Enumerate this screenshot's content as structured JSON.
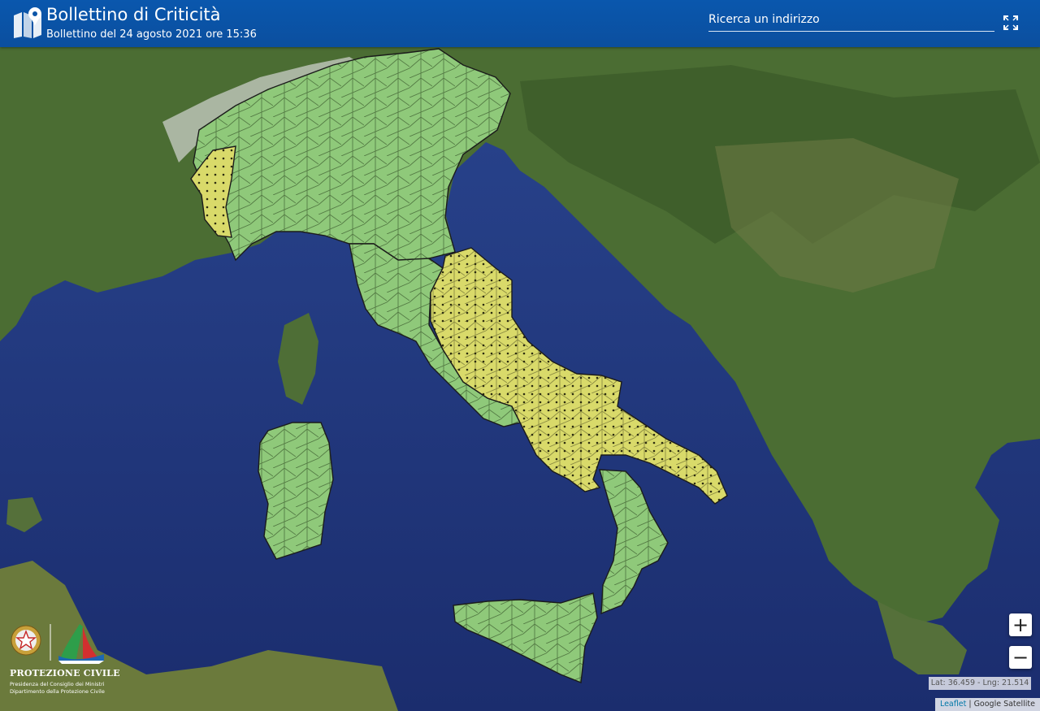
{
  "header": {
    "title": "Bollettino di Criticità",
    "subtitle": "Bollettino del 24 agosto 2021 ore 15:36",
    "search_placeholder": "Ricerca un indirizzo"
  },
  "map": {
    "zoom_in_label": "+",
    "zoom_out_label": "−",
    "coordinates": "Lat: 36.459 - Lng: 21.514",
    "attribution_link": "Leaflet",
    "attribution_sep": " | ",
    "attribution_source": "Google Satellite",
    "alert_levels": [
      {
        "level": "green",
        "color": "#8fc97a"
      },
      {
        "level": "yellow",
        "color": "#e0e06a"
      }
    ]
  },
  "logo": {
    "name": "PROTEZIONE CIVILE",
    "line1": "Presidenza del Consiglio dei Ministri",
    "line2": "Dipartimento della Protezione Civile"
  },
  "colors": {
    "header_bg": "#0b55a8",
    "sea": "#243a80",
    "land": "#4c6e34"
  }
}
